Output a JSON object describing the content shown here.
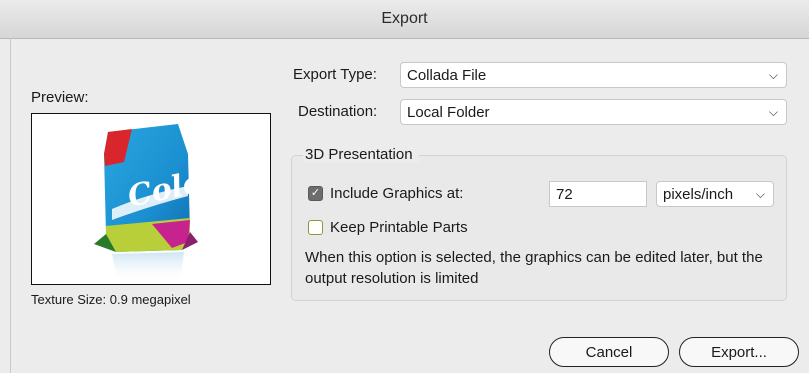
{
  "window": {
    "title": "Export"
  },
  "preview": {
    "label": "Preview:",
    "texture_size": "Texture Size: 0.9 megapixel",
    "product_text": "Color"
  },
  "export_type": {
    "label": "Export Type:",
    "value": "Collada File"
  },
  "destination": {
    "label": "Destination:",
    "value": "Local Folder"
  },
  "presentation": {
    "title": "3D Presentation",
    "include_graphics_label": "Include Graphics at:",
    "include_graphics_checked": true,
    "resolution_value": "72",
    "unit_value": "pixels/inch",
    "keep_printable_label": "Keep Printable Parts",
    "keep_printable_checked": false,
    "description": "When this option is selected, the graphics can be edited later, but the output resolution is limited"
  },
  "buttons": {
    "cancel": "Cancel",
    "export": "Export..."
  },
  "icons": {
    "chevron": "chevron-down-icon",
    "check": "checkmark-icon"
  }
}
